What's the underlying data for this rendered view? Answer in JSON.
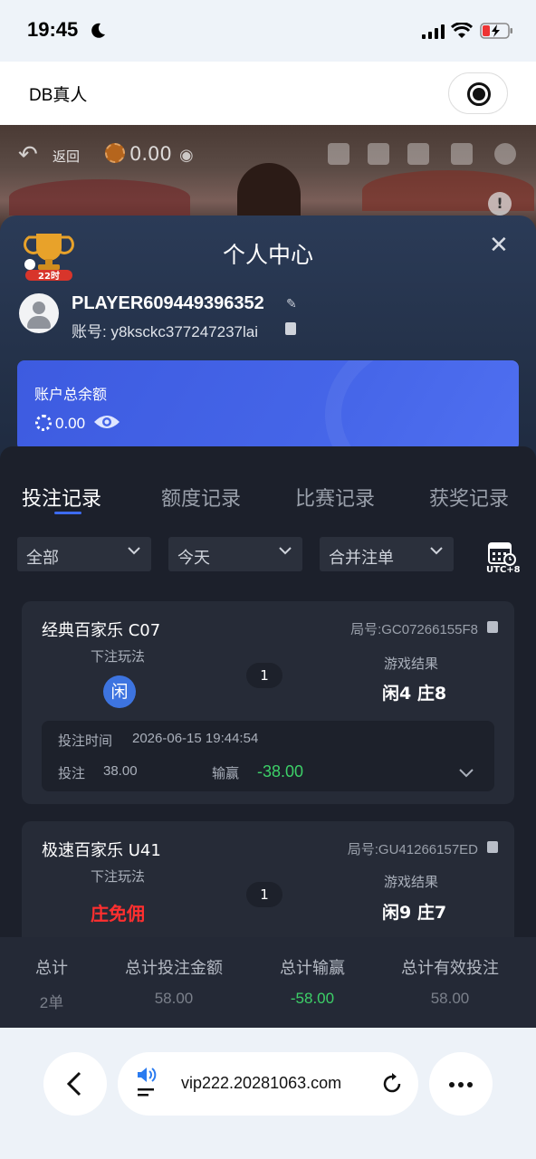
{
  "status_bar": {
    "time": "19:45"
  },
  "app_header": {
    "title": "DB真人"
  },
  "game_toolbar": {
    "back_label": "返回",
    "balance": "0.00"
  },
  "panel": {
    "title": "个人中心",
    "badge_text": "22时",
    "player_name": "PLAYER609449396352",
    "account": "账号: y8ksckc377247237lai",
    "balance_label": "账户总余额",
    "balance_value": "0.00"
  },
  "tabs": [
    {
      "label": "投注记录",
      "active": true
    },
    {
      "label": "额度记录",
      "active": false
    },
    {
      "label": "比赛记录",
      "active": false
    },
    {
      "label": "获奖记录",
      "active": false
    }
  ],
  "filters": [
    {
      "value": "全部"
    },
    {
      "value": "今天"
    },
    {
      "value": "合并注单"
    }
  ],
  "timezone": "UTC+8",
  "bets": [
    {
      "game": "经典百家乐 C07",
      "round": "局号:GC07266155F8",
      "bet_label": "下注玩法",
      "bet_value": "闲",
      "count": "1",
      "result_label": "游戏结果",
      "result": "闲4 庄8",
      "time_label": "投注时间",
      "time": "2026-06-15 19:44:54",
      "stake_label": "投注",
      "stake": "38.00",
      "win_label": "输赢",
      "win": "-38.00"
    },
    {
      "game": "极速百家乐 U41",
      "round": "局号:GU41266157ED",
      "bet_label": "下注玩法",
      "bet_value": "庄免佣",
      "count": "1",
      "result_label": "游戏结果",
      "result": "闲9 庄7"
    }
  ],
  "totals": {
    "labels": [
      "总计",
      "总计投注金额",
      "总计输赢",
      "总计有效投注"
    ],
    "values": [
      "2单",
      "58.00",
      "-58.00",
      "58.00"
    ]
  },
  "browser": {
    "url": "vip222.20281063.com"
  },
  "colors": {
    "accent": "#3d6bf0",
    "win_green": "#3dd068",
    "banker_red": "#ff2f2f",
    "player_blue": "#3d74e0"
  }
}
